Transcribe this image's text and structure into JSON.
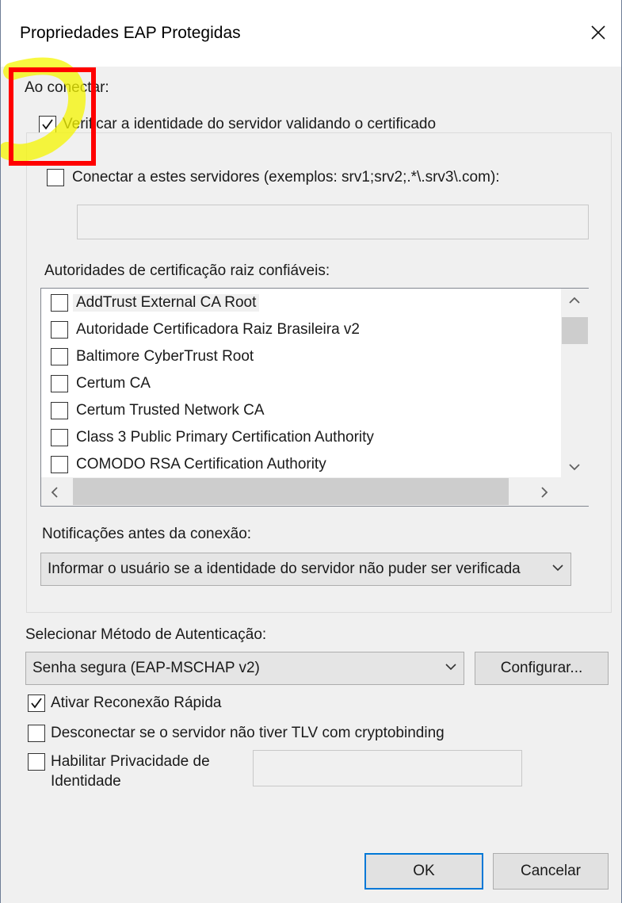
{
  "dialog": {
    "title": "Propriedades EAP Protegidas",
    "close_glyph": "×"
  },
  "connect": {
    "heading": "Ao conectar:",
    "verify_label": "Verificar a identidade do servidor validando o certificado",
    "verify_checked": true,
    "servers_label": "Conectar a estes servidores (exemplos: srv1;srv2;.*\\.srv3\\.com):",
    "servers_checked": false,
    "servers_value": "",
    "trusted_label": "Autoridades de certificação raiz confiáveis:",
    "authorities": [
      {
        "name": "AddTrust External CA Root",
        "checked": false
      },
      {
        "name": "Autoridade Certificadora Raiz Brasileira v2",
        "checked": false
      },
      {
        "name": "Baltimore CyberTrust Root",
        "checked": false
      },
      {
        "name": "Certum CA",
        "checked": false
      },
      {
        "name": "Certum Trusted Network CA",
        "checked": false
      },
      {
        "name": "Class 3 Public Primary Certification Authority",
        "checked": false
      },
      {
        "name": "COMODO RSA Certification Authority",
        "checked": false
      }
    ],
    "notifications_label": "Notificações antes da conexão:",
    "notifications_value": "Informar o usuário se a identidade do servidor não puder ser verificada"
  },
  "auth": {
    "method_label": "Selecionar Método de Autenticação:",
    "method_value": "Senha segura (EAP-MSCHAP v2)",
    "configure_label": "Configurar...",
    "fast_reconnect_label": "Ativar Reconexão Rápida",
    "fast_reconnect_checked": true,
    "disconnect_label": "Desconectar se o servidor não tiver TLV com cryptobinding",
    "disconnect_checked": false,
    "privacy_label_line1": "Habilitar Privacidade de",
    "privacy_label_line2": "Identidade",
    "privacy_checked": false,
    "privacy_value": ""
  },
  "footer": {
    "ok_label": "OK",
    "cancel_label": "Cancelar"
  },
  "icons": {
    "scroll_up": "chevron-up-icon",
    "scroll_down": "chevron-down-icon",
    "scroll_left": "chevron-left-icon",
    "scroll_right": "chevron-right-icon",
    "dropdown": "chevron-down-icon"
  },
  "colors": {
    "annotation_box": "#ff0000",
    "annotation_highlight": "#f5f500",
    "default_button_border": "#0078d7"
  }
}
